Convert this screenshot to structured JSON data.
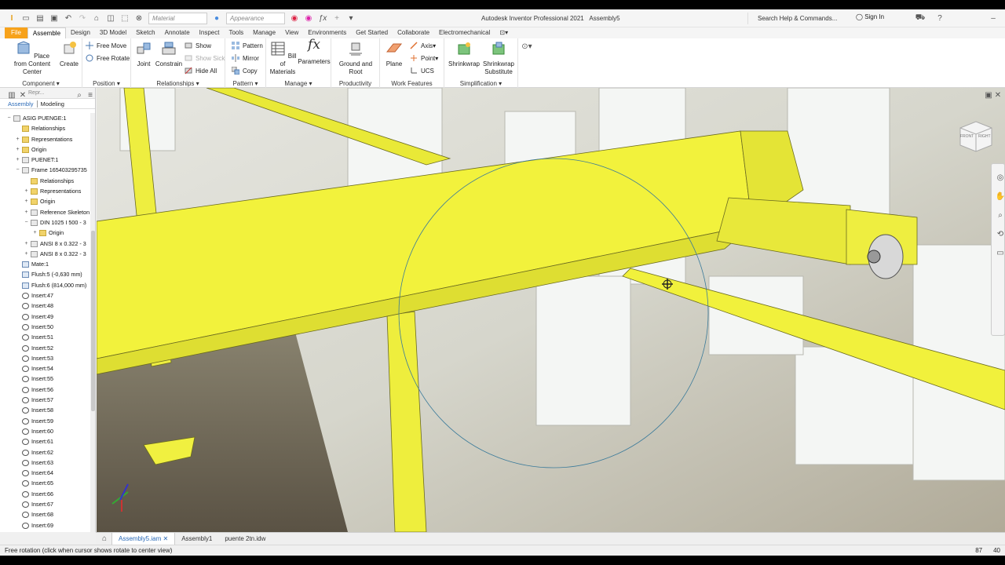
{
  "app": {
    "title": "Autodesk Inventor Professional 2021",
    "document": "Assembly5"
  },
  "qat": {
    "material_placeholder": "Material",
    "appearance_placeholder": "Appearance"
  },
  "header": {
    "search": "Search Help & Commands...",
    "sign_in": "Sign In"
  },
  "ribbon_tabs": [
    "File",
    "Assemble",
    "Design",
    "3D Model",
    "Sketch",
    "Annotate",
    "Inspect",
    "Tools",
    "Manage",
    "View",
    "Environments",
    "Get Started",
    "Collaborate",
    "Electromechanical"
  ],
  "active_tab": "Assemble",
  "panels": {
    "component": {
      "title": "Component",
      "place": "Place from Content Center",
      "create": "Create"
    },
    "position": {
      "title": "Position",
      "free_move": "Free Move",
      "free_rotate": "Free Rotate"
    },
    "relationships": {
      "title": "Relationships",
      "joint": "Joint",
      "constrain": "Constrain",
      "show": "Show",
      "show_sick": "Show Sick",
      "hide_all": "Hide All"
    },
    "pattern": {
      "title": "Pattern",
      "pattern": "Pattern",
      "mirror": "Mirror",
      "copy": "Copy"
    },
    "manage": {
      "title": "Manage",
      "bom": "Bill of Materials",
      "parameters": "Parameters"
    },
    "productivity": {
      "title": "Productivity",
      "ground": "Ground and Root"
    },
    "work_features": {
      "title": "Work Features",
      "plane": "Plane",
      "axis": "Axis",
      "point": "Point",
      "ucs": "UCS"
    },
    "simplification": {
      "title": "Simplification",
      "shrinkwrap": "Shrinkwrap",
      "shrinkwrap_sub": "Shrinkwrap Substitute"
    }
  },
  "browser": {
    "search_placeholder": "Repr...",
    "tabs": [
      "Assembly",
      "Modeling"
    ],
    "tree": [
      {
        "label": "ASIG PUENGE:1",
        "indent": 0,
        "exp": "-",
        "icon": "asm"
      },
      {
        "label": "Relationships",
        "indent": 1,
        "exp": "",
        "icon": "fold"
      },
      {
        "label": "Representations",
        "indent": 1,
        "exp": "+",
        "icon": "fold"
      },
      {
        "label": "Origin",
        "indent": 1,
        "exp": "+",
        "icon": "fold"
      },
      {
        "label": "PUENET:1",
        "indent": 1,
        "exp": "+",
        "icon": "asm"
      },
      {
        "label": "Frame 165403295735",
        "indent": 1,
        "exp": "-",
        "icon": "asm"
      },
      {
        "label": "Relationships",
        "indent": 2,
        "exp": "",
        "icon": "fold"
      },
      {
        "label": "Representations",
        "indent": 2,
        "exp": "+",
        "icon": "fold"
      },
      {
        "label": "Origin",
        "indent": 2,
        "exp": "+",
        "icon": "fold"
      },
      {
        "label": "Reference Skeleton",
        "indent": 2,
        "exp": "+",
        "icon": "asm"
      },
      {
        "label": "DIN 1025 I 500 - 3",
        "indent": 2,
        "exp": "-",
        "icon": "asm"
      },
      {
        "label": "Origin",
        "indent": 3,
        "exp": "+",
        "icon": "fold"
      },
      {
        "label": "ANSI 8 x 0.322 - 3",
        "indent": 2,
        "exp": "+",
        "icon": "asm"
      },
      {
        "label": "ANSI 8 x 0.322 - 3",
        "indent": 2,
        "exp": "+",
        "icon": "asm"
      },
      {
        "label": "Mate:1",
        "indent": 1,
        "exp": "",
        "icon": "mate"
      },
      {
        "label": "Flush:5 (-0,630 mm)",
        "indent": 1,
        "exp": "",
        "icon": "mate"
      },
      {
        "label": "Flush:6 (814,000 mm)",
        "indent": 1,
        "exp": "",
        "icon": "mate"
      },
      {
        "label": "Insert:47",
        "indent": 1,
        "exp": "",
        "icon": "ins"
      },
      {
        "label": "Insert:48",
        "indent": 1,
        "exp": "",
        "icon": "ins"
      },
      {
        "label": "Insert:49",
        "indent": 1,
        "exp": "",
        "icon": "ins"
      },
      {
        "label": "Insert:50",
        "indent": 1,
        "exp": "",
        "icon": "ins"
      },
      {
        "label": "Insert:51",
        "indent": 1,
        "exp": "",
        "icon": "ins"
      },
      {
        "label": "Insert:52",
        "indent": 1,
        "exp": "",
        "icon": "ins"
      },
      {
        "label": "Insert:53",
        "indent": 1,
        "exp": "",
        "icon": "ins"
      },
      {
        "label": "Insert:54",
        "indent": 1,
        "exp": "",
        "icon": "ins"
      },
      {
        "label": "Insert:55",
        "indent": 1,
        "exp": "",
        "icon": "ins"
      },
      {
        "label": "Insert:56",
        "indent": 1,
        "exp": "",
        "icon": "ins"
      },
      {
        "label": "Insert:57",
        "indent": 1,
        "exp": "",
        "icon": "ins"
      },
      {
        "label": "Insert:58",
        "indent": 1,
        "exp": "",
        "icon": "ins"
      },
      {
        "label": "Insert:59",
        "indent": 1,
        "exp": "",
        "icon": "ins"
      },
      {
        "label": "Insert:60",
        "indent": 1,
        "exp": "",
        "icon": "ins"
      },
      {
        "label": "Insert:61",
        "indent": 1,
        "exp": "",
        "icon": "ins"
      },
      {
        "label": "Insert:62",
        "indent": 1,
        "exp": "",
        "icon": "ins"
      },
      {
        "label": "Insert:63",
        "indent": 1,
        "exp": "",
        "icon": "ins"
      },
      {
        "label": "Insert:64",
        "indent": 1,
        "exp": "",
        "icon": "ins"
      },
      {
        "label": "Insert:65",
        "indent": 1,
        "exp": "",
        "icon": "ins"
      },
      {
        "label": "Insert:66",
        "indent": 1,
        "exp": "",
        "icon": "ins"
      },
      {
        "label": "Insert:67",
        "indent": 1,
        "exp": "",
        "icon": "ins"
      },
      {
        "label": "Insert:68",
        "indent": 1,
        "exp": "",
        "icon": "ins"
      },
      {
        "label": "Insert:69",
        "indent": 1,
        "exp": "",
        "icon": "ins"
      }
    ]
  },
  "viewcube": {
    "face1": "FRONT",
    "face2": "RIGHT"
  },
  "doc_tabs": [
    "Assembly5.iam",
    "Assembly1",
    "puente 2tn.idw"
  ],
  "status": {
    "message": "Free rotation (click when cursor shows rotate to center view)",
    "n1": "87",
    "n2": "40"
  },
  "colors": {
    "file_tab": "#f7a21b",
    "beam": "#f2f23c",
    "accent": "#2a6ab7"
  }
}
